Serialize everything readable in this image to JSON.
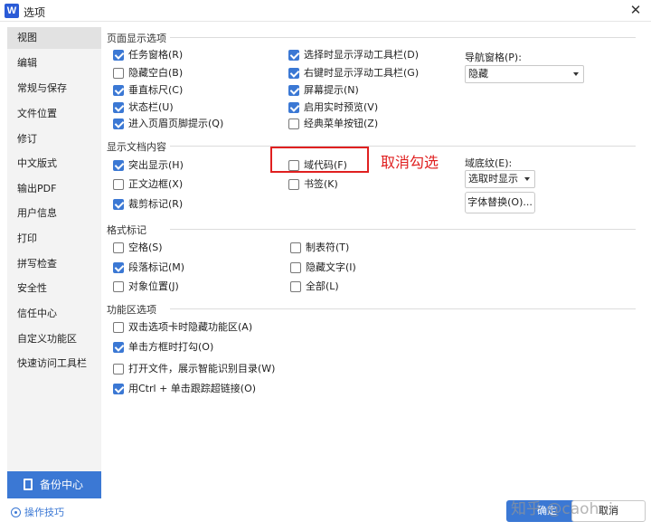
{
  "window": {
    "title": "选项",
    "app_icon": "W"
  },
  "sidebar": {
    "items": [
      {
        "label": "视图",
        "active": true
      },
      {
        "label": "编辑"
      },
      {
        "label": "常规与保存"
      },
      {
        "label": "文件位置"
      },
      {
        "label": "修订"
      },
      {
        "label": "中文版式"
      },
      {
        "label": "输出PDF"
      },
      {
        "label": "用户信息"
      },
      {
        "label": "打印"
      },
      {
        "label": "拼写检查"
      },
      {
        "label": "安全性"
      },
      {
        "label": "信任中心"
      },
      {
        "label": "自定义功能区"
      },
      {
        "label": "快速访问工具栏"
      }
    ],
    "backup_label": "备份中心",
    "tips_label": "操作技巧"
  },
  "sections": {
    "page_display": {
      "title": "页面显示选项",
      "col1": [
        {
          "label": "任务窗格(R)",
          "checked": true
        },
        {
          "label": "隐藏空白(B)",
          "checked": false
        },
        {
          "label": "垂直标尺(C)",
          "checked": true
        },
        {
          "label": "状态栏(U)",
          "checked": true
        },
        {
          "label": "进入页眉页脚提示(Q)",
          "checked": true
        }
      ],
      "col2": [
        {
          "label": "选择时显示浮动工具栏(D)",
          "checked": true
        },
        {
          "label": "右键时显示浮动工具栏(G)",
          "checked": true
        },
        {
          "label": "屏幕提示(N)",
          "checked": true
        },
        {
          "label": "启用实时预览(V)",
          "checked": true
        },
        {
          "label": "经典菜单按钮(Z)",
          "checked": false
        }
      ],
      "nav_pane_label": "导航窗格(P):",
      "nav_pane_value": "隐藏"
    },
    "doc_content": {
      "title": "显示文档内容",
      "col1": [
        {
          "label": "突出显示(H)",
          "checked": true
        },
        {
          "label": "正文边框(X)",
          "checked": false
        },
        {
          "label": "裁剪标记(R)",
          "checked": true
        }
      ],
      "col2": [
        {
          "label": "域代码(F)",
          "checked": false
        },
        {
          "label": "书签(K)",
          "checked": false
        }
      ],
      "field_shading_label": "域底纹(E):",
      "field_shading_value": "选取时显示",
      "font_replace_label": "字体替换(O)..."
    },
    "format_marks": {
      "title": "格式标记",
      "col1": [
        {
          "label": "空格(S)",
          "checked": false
        },
        {
          "label": "段落标记(M)",
          "checked": true
        },
        {
          "label": "对象位置(J)",
          "checked": false
        }
      ],
      "col2": [
        {
          "label": "制表符(T)",
          "checked": false
        },
        {
          "label": "隐藏文字(I)",
          "checked": false
        },
        {
          "label": "全部(L)",
          "checked": false
        }
      ]
    },
    "ribbon": {
      "title": "功能区选项",
      "items": [
        {
          "label": "双击选项卡时隐藏功能区(A)",
          "checked": false
        },
        {
          "label": "单击方框时打勾(O)",
          "checked": true
        },
        {
          "label": "打开文件，展示智能识别目录(W)",
          "checked": false
        },
        {
          "label": "用Ctrl + 单击跟踪超链接(O)",
          "checked": true
        }
      ]
    }
  },
  "annotation": {
    "text": "取消勾选",
    "color": "#e02020"
  },
  "footer": {
    "ok_label": "确定",
    "cancel_label": "取消"
  },
  "watermark": "知乎 @caohui",
  "colors": {
    "accent": "#3b78d4",
    "annotation": "#e02020"
  }
}
